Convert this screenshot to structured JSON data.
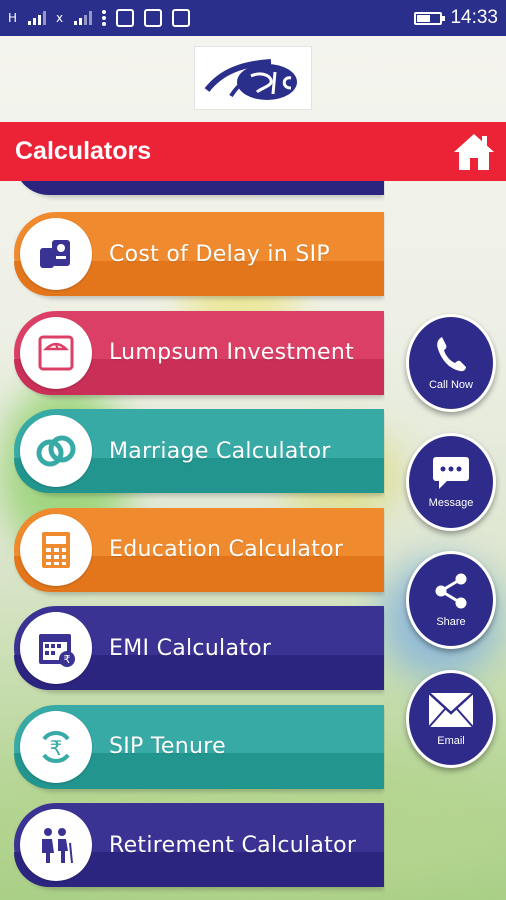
{
  "status_bar": {
    "left_text": "H",
    "left_text2": "x",
    "time": "14:33",
    "battery_level": 0.55
  },
  "app_bar": {
    "title": "Calculators",
    "home_icon": "home-icon"
  },
  "calculators": [
    {
      "label": "Cost of Delay in SIP",
      "color": "#ef8a2f",
      "band": "#e3761b",
      "icon": "hand-money-icon"
    },
    {
      "label": "Lumpsum Investment",
      "color": "#dc3f66",
      "band": "#c92f57",
      "icon": "weighing-scale-icon"
    },
    {
      "label": "Marriage Calculator",
      "color": "#37aaa6",
      "band": "#22958f",
      "icon": "rings-icon"
    },
    {
      "label": "Education Calculator",
      "color": "#ef8a2f",
      "band": "#e3761b",
      "icon": "calculator-icon"
    },
    {
      "label": "EMI Calculator",
      "color": "#3a3394",
      "band": "#2c2580",
      "icon": "calendar-rupee-icon"
    },
    {
      "label": "SIP Tenure",
      "color": "#37aaa6",
      "band": "#22958f",
      "icon": "rupee-cycle-icon"
    },
    {
      "label": "Retirement Calculator",
      "color": "#3a3394",
      "band": "#2c2580",
      "icon": "elderly-couple-icon"
    }
  ],
  "actions": [
    {
      "label": "Call Now",
      "icon": "phone-icon"
    },
    {
      "label": "Message",
      "icon": "message-icon"
    },
    {
      "label": "Share",
      "icon": "share-icon"
    },
    {
      "label": "Email",
      "icon": "email-icon"
    }
  ]
}
